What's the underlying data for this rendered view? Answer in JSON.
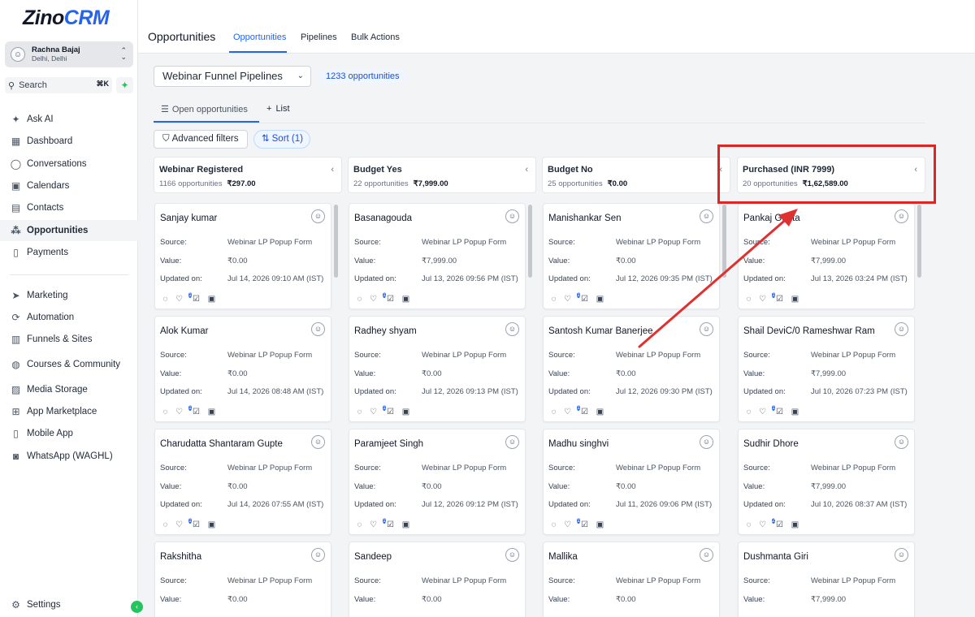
{
  "app": {
    "logo_main": "Zino",
    "logo_accent": "CRM"
  },
  "user": {
    "name": "Rachna Bajaj",
    "location": "Delhi, Delhi"
  },
  "search": {
    "label": "Search",
    "shortcut": "⌘K"
  },
  "nav": {
    "items": [
      {
        "label": "Ask AI",
        "icon": "sparkle-icon"
      },
      {
        "label": "Dashboard",
        "icon": "grid-icon"
      },
      {
        "label": "Conversations",
        "icon": "chat-icon"
      },
      {
        "label": "Calendars",
        "icon": "calendar-icon"
      },
      {
        "label": "Contacts",
        "icon": "contacts-icon"
      },
      {
        "label": "Opportunities",
        "icon": "opportunities-icon"
      },
      {
        "label": "Payments",
        "icon": "payments-icon"
      },
      {
        "label": "Marketing",
        "icon": "send-icon"
      },
      {
        "label": "Automation",
        "icon": "automation-icon"
      },
      {
        "label": "Funnels & Sites",
        "icon": "funnel-icon"
      },
      {
        "label": "Courses & Community",
        "icon": "courses-icon"
      },
      {
        "label": "Media Storage",
        "icon": "image-icon"
      },
      {
        "label": "App Marketplace",
        "icon": "apps-icon"
      },
      {
        "label": "Mobile App",
        "icon": "mobile-icon"
      },
      {
        "label": "WhatsApp (WAGHL)",
        "icon": "whatsapp-icon"
      }
    ],
    "settings": "Settings"
  },
  "header": {
    "title": "Opportunities",
    "tabs": [
      "Opportunities",
      "Pipelines",
      "Bulk Actions"
    ]
  },
  "toolbar": {
    "pipeline": "Webinar Funnel Pipelines",
    "count": "1233 opportunities",
    "views": [
      "Open opportunities",
      "List"
    ],
    "filters": "Advanced filters",
    "sort": "Sort (1)"
  },
  "card_labels": {
    "source": "Source:",
    "value": "Value:",
    "updated": "Updated on:"
  },
  "columns": [
    {
      "title": "Webinar Registered",
      "count": "1166 opportunities",
      "amount": "₹297.00",
      "cards": [
        {
          "name": "Sanjay kumar",
          "source": "Webinar LP Popup Form",
          "value": "₹0.00",
          "updated": "Jul 14, 2026 09:10 AM (IST)",
          "badge": "1"
        },
        {
          "name": "Alok Kumar",
          "source": "Webinar LP Popup Form",
          "value": "₹0.00",
          "updated": "Jul 14, 2026 08:48 AM (IST)",
          "badge": "1"
        },
        {
          "name": "Charudatta Shantaram Gupte",
          "source": "Webinar LP Popup Form",
          "value": "₹0.00",
          "updated": "Jul 14, 2026 07:55 AM (IST)",
          "badge": "1"
        },
        {
          "name": "Rakshitha",
          "source": "Webinar LP Popup Form",
          "value": "₹0.00"
        }
      ]
    },
    {
      "title": "Budget Yes",
      "count": "22 opportunities",
      "amount": "₹7,999.00",
      "cards": [
        {
          "name": "Basanagouda",
          "source": "Webinar LP Popup Form",
          "value": "₹7,999.00",
          "updated": "Jul 13, 2026 09:56 PM (IST)",
          "badge": "1"
        },
        {
          "name": "Radhey shyam",
          "source": "Webinar LP Popup Form",
          "value": "₹0.00",
          "updated": "Jul 12, 2026 09:13 PM (IST)",
          "badge": "1"
        },
        {
          "name": "Paramjeet Singh",
          "source": "Webinar LP Popup Form",
          "value": "₹0.00",
          "updated": "Jul 12, 2026 09:12 PM (IST)",
          "badge": "1"
        },
        {
          "name": "Sandeep",
          "source": "Webinar LP Popup Form",
          "value": "₹0.00"
        }
      ]
    },
    {
      "title": "Budget No",
      "count": "25 opportunities",
      "amount": "₹0.00",
      "cards": [
        {
          "name": "Manishankar Sen",
          "source": "Webinar LP Popup Form",
          "value": "₹0.00",
          "updated": "Jul 12, 2026 09:35 PM (IST)",
          "badge": "1"
        },
        {
          "name": "Santosh Kumar Banerjee",
          "source": "Webinar LP Popup Form",
          "value": "₹0.00",
          "updated": "Jul 12, 2026 09:30 PM (IST)",
          "badge": "1"
        },
        {
          "name": "Madhu singhvi",
          "source": "Webinar LP Popup Form",
          "value": "₹0.00",
          "updated": "Jul 11, 2026 09:06 PM (IST)",
          "badge": "1"
        },
        {
          "name": "Mallika",
          "source": "Webinar LP Popup Form",
          "value": "₹0.00"
        }
      ]
    },
    {
      "title": "Purchased (INR 7999)",
      "count": "20 opportunities",
      "amount": "₹1,62,589.00",
      "cards": [
        {
          "name": "Pankaj Gupta",
          "source": "Webinar LP Popup Form",
          "value": "₹7,999.00",
          "updated": "Jul 13, 2026 03:24 PM (IST)",
          "badge": "1"
        },
        {
          "name": "Shail DeviC/0 Rameshwar Ram",
          "source": "Webinar LP Popup Form",
          "value": "₹7,999.00",
          "updated": "Jul 10, 2026 07:23 PM (IST)",
          "badge": "1"
        },
        {
          "name": "Sudhir Dhore",
          "source": "Webinar LP Popup Form",
          "value": "₹7,999.00",
          "updated": "Jul 10, 2026 08:37 AM (IST)",
          "badge": "2"
        },
        {
          "name": "Dushmanta Giri",
          "source": "Webinar LP Popup Form",
          "value": "₹7,999.00"
        }
      ]
    }
  ],
  "colors": {
    "accent": "#2563eb",
    "annotation": "#dc2626",
    "brand_green": "#22c55e"
  }
}
